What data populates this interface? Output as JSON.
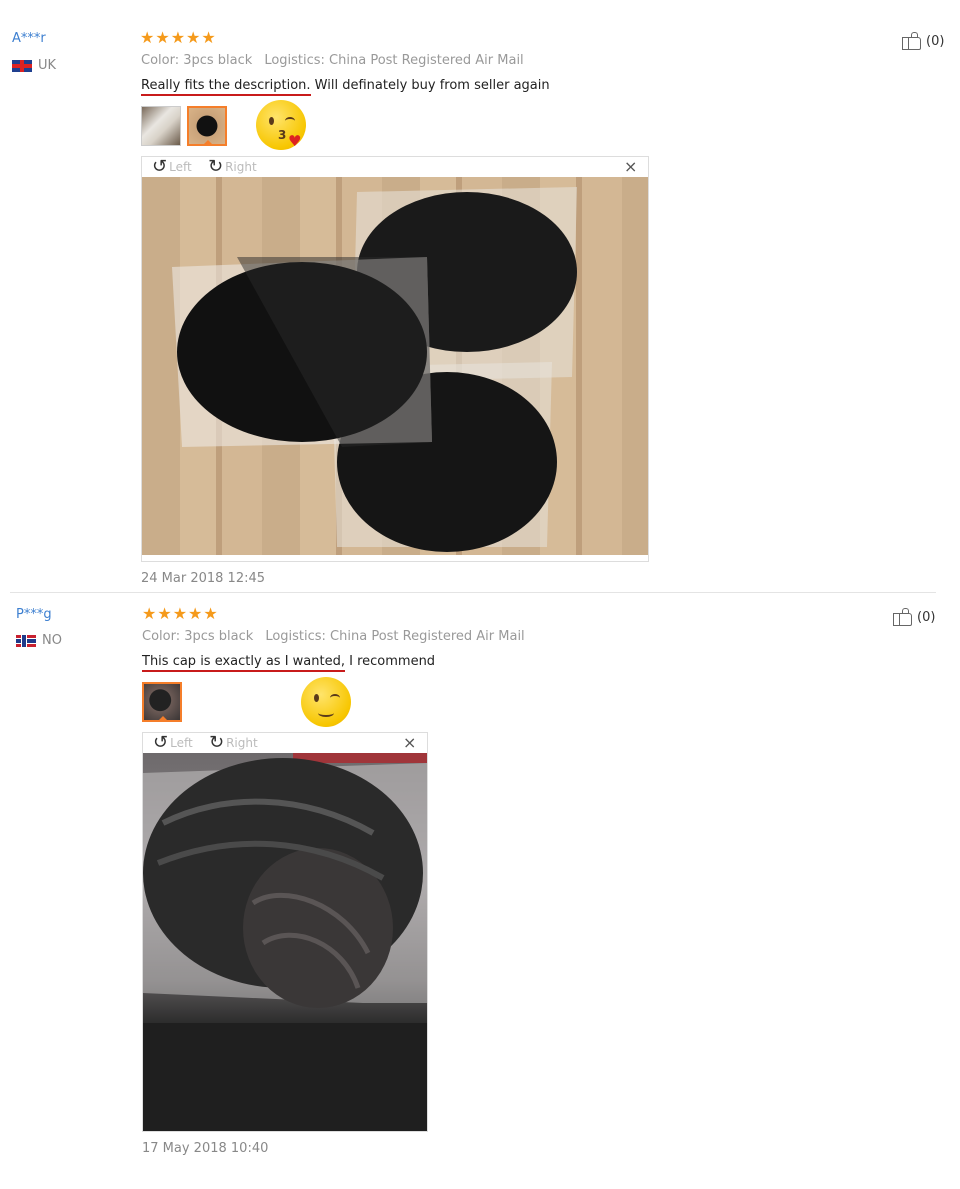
{
  "reviews": [
    {
      "user": "A***r",
      "country": "UK",
      "stars": "★★★★★",
      "color": "Color: 3pcs black",
      "logistics": "Logistics: China Post Registered Air Mail",
      "text_highlight": "Really fits the description.",
      "text_rest": " Will definately buy from seller again",
      "likes": "(0)",
      "emoji_number": "3",
      "rotate_left": "Left",
      "rotate_right": "Right",
      "close": "×",
      "date": "24 Mar 2018 12:45"
    },
    {
      "user": "P***g",
      "country": "NO",
      "stars": "★★★★★",
      "color": "Color: 3pcs black",
      "logistics": "Logistics: China Post Registered Air Mail",
      "text_highlight": "This cap is exactly as I wanted,",
      "text_rest": " I recommend",
      "likes": "(0)",
      "rotate_left": "Left",
      "rotate_right": "Right",
      "close": "×",
      "date": "17 May 2018 10:40"
    }
  ],
  "colors": {
    "username": "#3c7fd0",
    "stars": "#f59a1b",
    "underline": "#c81b1b",
    "selected_thumb": "#f57e2a"
  }
}
